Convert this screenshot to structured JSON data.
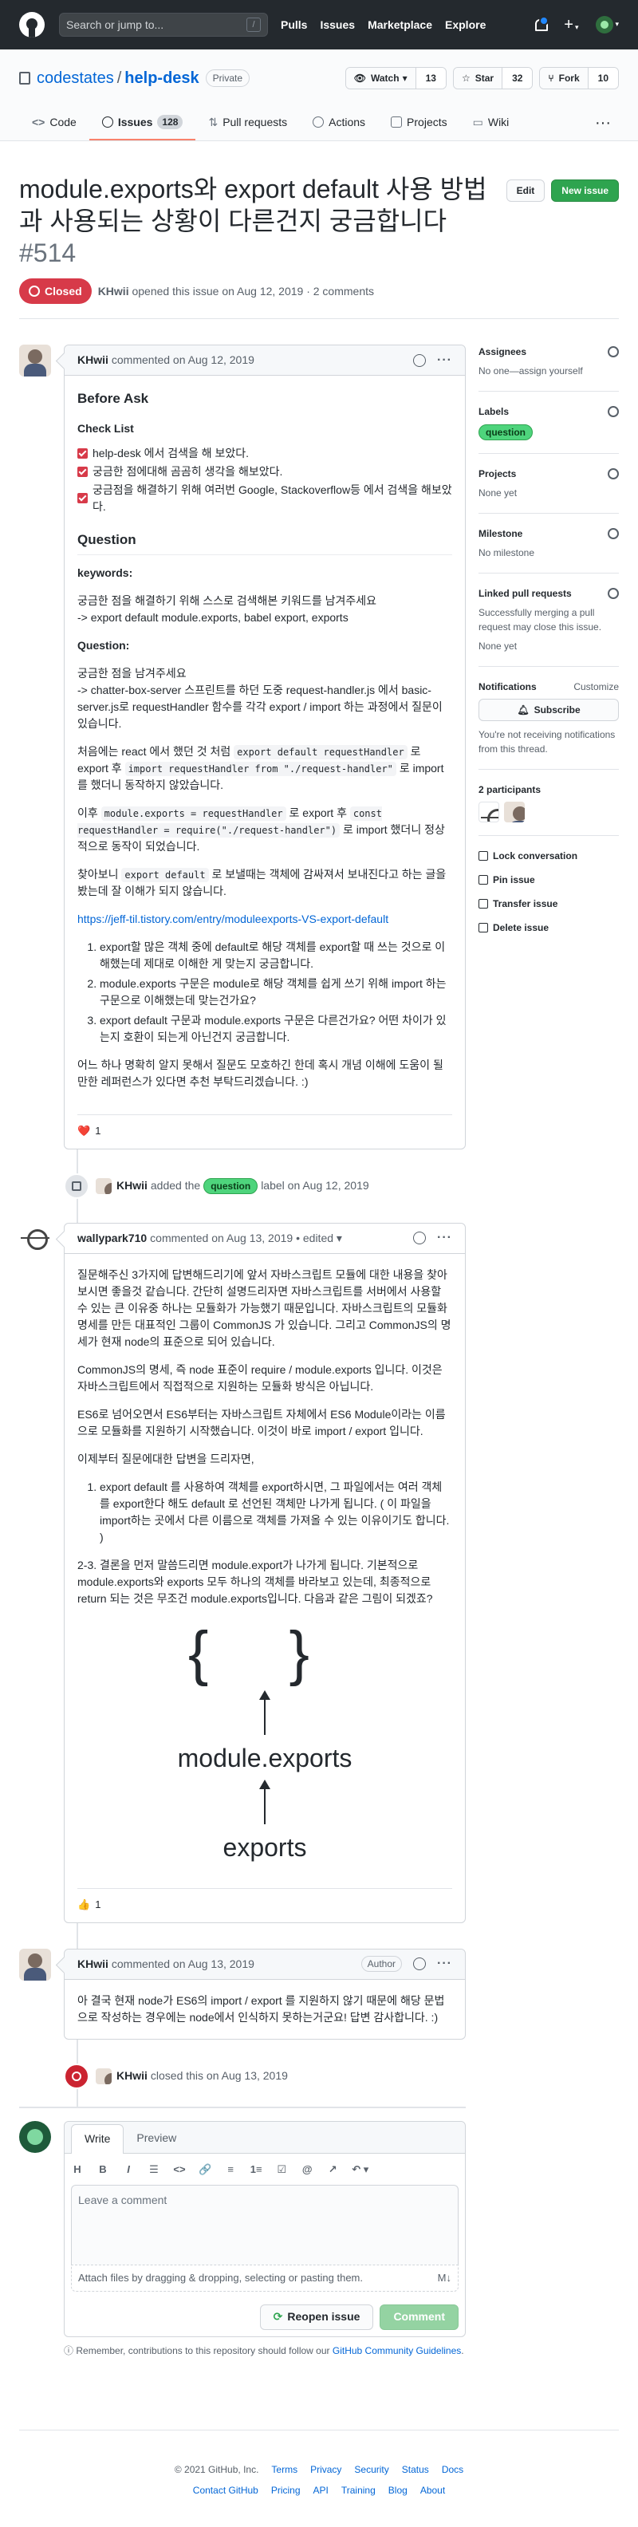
{
  "header": {
    "search_placeholder": "Search or jump to...",
    "search_key": "/",
    "nav": [
      "Pulls",
      "Issues",
      "Marketplace",
      "Explore"
    ]
  },
  "repo": {
    "owner": "codestates",
    "name": "help-desk",
    "visibility": "Private",
    "watch_label": "Watch",
    "watch_count": "13",
    "star_label": "Star",
    "star_count": "32",
    "fork_label": "Fork",
    "fork_count": "10",
    "tabs": [
      {
        "label": "Code"
      },
      {
        "label": "Issues",
        "count": "128"
      },
      {
        "label": "Pull requests"
      },
      {
        "label": "Actions"
      },
      {
        "label": "Projects"
      },
      {
        "label": "Wiki"
      }
    ]
  },
  "issue": {
    "title": "module.exports와 export default 사용 방법과 사용되는 상황이 다른건지 궁금합니다",
    "number": "#514",
    "edit_label": "Edit",
    "new_issue_label": "New issue",
    "state": "Closed",
    "author": "KHwii",
    "meta_rest": "opened this issue on Aug 12, 2019 · 2 comments"
  },
  "c1": {
    "author": "KHwii",
    "meta": "commented on Aug 12, 2019",
    "h_before": "Before Ask",
    "h_check": "Check List",
    "checks": [
      "help-desk 에서 검색을 해 보았다.",
      "궁금한 점에대해 곰곰히 생각을 해보았다.",
      "궁금점을 해결하기 위해 여러번 Google, Stackoverflow등 에서 검색을 해보았다."
    ],
    "h_question": "Question",
    "h_keywords": "keywords:",
    "kw1": "궁금한 점을 해결하기 위해 스스로 검색해본 키워드를 남겨주세요",
    "kw2": "-> export default module.exports, babel export, exports",
    "h_q2": "Question:",
    "q1": "궁금한 점을 남겨주세요",
    "q2": "-> chatter-box-server 스프린트를 하던 도중 request-handler.js 에서 basic-server.js로 requestHandler 함수를 각각 export / import 하는 과정에서 질문이 있습니다.",
    "p3a": "처음에는 react 에서 했던 것 처럼",
    "p3code1": "export default requestHandler",
    "p3b": "로 export 후",
    "p3code2": "import requestHandler from \"./request-handler\"",
    "p3c": "로 import를 했더니 동작하지 않았습니다.",
    "p4a": "이후",
    "p4code1": "module.exports = requestHandler",
    "p4b": "로 export 후",
    "p4code2": "const requestHandler = require(\"./request-handler\")",
    "p4c": "로 import 했더니 정상적으로 동작이 되었습니다.",
    "p5a": "찾아보니",
    "p5code": "export default",
    "p5b": "로 보낼때는 객체에 감싸져서 보내진다고 하는 글을 봤는데 잘 이해가 되지 않습니다.",
    "link": "https://jeff-til.tistory.com/entry/moduleexports-VS-export-default",
    "ol": [
      "export할 많은 객체 중에 default로 해당 객체를 export할 때 쓰는 것으로 이해했는데 제대로 이해한 게 맞는지 궁금합니다.",
      "module.exports 구문은 module로 해당 객체를 쉽게 쓰기 위해 import 하는 구문으로 이해했는데 맞는건가요?",
      "export default 구문과 module.exports 구문은 다른건가요? 어떤 차이가 있는지 호환이 되는게 아닌건지 궁금합니다."
    ],
    "last": "어느 하나 명확히 알지 못해서 질문도 모호하긴 한데 혹시 개념 이해에 도움이 될 만한 레퍼런스가 있다면 추천 부탁드리겠습니다. :)",
    "reaction": "❤️",
    "reaction_count": "1"
  },
  "ev_label": {
    "author": "KHwii",
    "pre": "added the",
    "label": "question",
    "post": "label on Aug 12, 2019"
  },
  "c2": {
    "author": "wallypark710",
    "meta": "commented on Aug 13, 2019 • edited ▾",
    "p1": "질문해주신 3가지에 답변해드리기에 앞서 자바스크립트 모듈에 대한 내용을 찾아보시면 좋을것 같습니다. 간단히 설명드리자면 자바스크립트를 서버에서 사용할 수 있는 큰 이유중 하나는 모듈화가 가능했기 때문입니다. 자바스크립트의 모듈화 명세를 만든 대표적인 그룹이 CommonJS 가 있습니다. 그리고 CommonJS의 명세가 현재 node의 표준으로 되어 있습니다.",
    "p2": "CommonJS의 명세, 즉 node 표준이 require / module.exports 입니다. 이것은 자바스크립트에서 직접적으로 지원하는 모듈화 방식은 아닙니다.",
    "p3": "ES6로 넘어오면서 ES6부터는 자바스크립트 자체에서 ES6 Module이라는 이름으로 모듈화를 지원하기 시작했습니다. 이것이 바로 import / export 입니다.",
    "p4": "이제부터 질문에대한 답변을 드리자면,",
    "ol1": "export default 를 사용하여 객체를 export하시면, 그 파일에서는 여러 객체를 export한다 해도 default 로 선언된 객체만 나가게 됩니다. ( 이 파일을 import하는 곳에서 다른 이름으로 객체를 가져올 수 있는 이유이기도 합니다. )",
    "p5": "2-3. 결론을 먼저 말씀드리면 module.export가 나가게 됩니다. 기본적으로 module.exports와 exports 모두 하나의 객체를 바라보고 있는데, 최종적으로 return 되는 것은 무조건 module.exports입니다. 다음과 같은 그림이 되겠죠?",
    "diagram": {
      "braces": "{ }",
      "mid": "module.exports",
      "bottom": "exports"
    },
    "reaction": "👍",
    "reaction_count": "1"
  },
  "c3": {
    "author": "KHwii",
    "meta": "commented on Aug 13, 2019",
    "badge": "Author",
    "text": "아 결국 현재 node가 ES6의 import / export 를 지원하지 않기 때문에 해당 문법으로 작성하는 경우에는 node에서 인식하지 못하는거군요! 답변 감사합니다. :)"
  },
  "ev_closed": {
    "author": "KHwii",
    "text": "closed this on Aug 13, 2019"
  },
  "composer": {
    "tab_write": "Write",
    "tab_preview": "Preview",
    "tools": [
      "H",
      "B",
      "I",
      "☰",
      "<>",
      "🔗",
      "≡",
      "1≡",
      "☑",
      "@",
      "↗",
      "↶ ▾"
    ],
    "placeholder": "Leave a comment",
    "attach": "Attach files by dragging & dropping, selecting or pasting them.",
    "md": "M↓",
    "reopen": "Reopen issue",
    "comment": "Comment",
    "note_pre": "Remember, contributions to this repository should follow our",
    "note_link": "GitHub Community Guidelines",
    "note_post": "."
  },
  "sidebar": {
    "assignees": {
      "title": "Assignees",
      "value": "No one—assign yourself"
    },
    "labels": {
      "title": "Labels",
      "value": "question"
    },
    "projects": {
      "title": "Projects",
      "value": "None yet"
    },
    "milestone": {
      "title": "Milestone",
      "value": "No milestone"
    },
    "linked": {
      "title": "Linked pull requests",
      "desc": "Successfully merging a pull request may close this issue.",
      "value": "None yet"
    },
    "notifications": {
      "title": "Notifications",
      "customize": "Customize",
      "button": "Subscribe",
      "desc": "You're not receiving notifications from this thread."
    },
    "participants": {
      "title": "2 participants"
    },
    "actions": [
      "Lock conversation",
      "Pin issue",
      "Transfer issue",
      "Delete issue"
    ]
  },
  "footer": {
    "row1": [
      "© 2021 GitHub, Inc.",
      "Terms",
      "Privacy",
      "Security",
      "Status",
      "Docs"
    ],
    "row2": [
      "Contact GitHub",
      "Pricing",
      "API",
      "Training",
      "Blog",
      "About"
    ]
  }
}
